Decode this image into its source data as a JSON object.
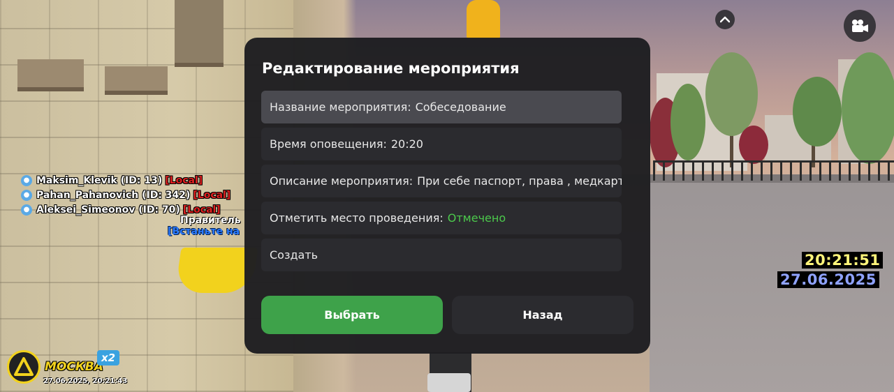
{
  "dialog": {
    "title": "Редактирование мероприятия",
    "items": [
      {
        "label": "Название мероприятия:",
        "value": "Собеседование"
      },
      {
        "label": "Время оповещения:",
        "value": "20:20"
      },
      {
        "label": "Описание мероприятия:",
        "value": " При себе паспорт, права , медкарта"
      },
      {
        "label": "Отметить место проведения:",
        "value": "Отмечено",
        "value_color": "#4cc94c"
      },
      {
        "label": "Создать"
      }
    ],
    "select_label": "Выбрать",
    "back_label": "Назад"
  },
  "players": [
    {
      "name": "Maksim_Klevik (ID: 13)",
      "tag": "[Local]"
    },
    {
      "name": "Pahan_Pahanovich (ID: 342)",
      "tag": "[Local]"
    },
    {
      "name": "Aleksei_Simeonov (ID: 70)",
      "tag": "[Local]"
    }
  ],
  "npc_labels": {
    "line1": "Правитель",
    "line2": "[Встаньте на"
  },
  "clock": {
    "time": "20:21:51",
    "date": "27.06.2025"
  },
  "server": {
    "city": "МОСКВА",
    "multiplier": "x2",
    "datetime": "27.06.2025, 20:21:43"
  },
  "icons": {
    "collapse": "chevron-up-icon",
    "camera": "video-camera-icon",
    "voice": "microphone-icon",
    "logo": "server-logo-icon"
  },
  "colors": {
    "accent_green": "#3ea24a",
    "success_text": "#4cc94c",
    "local_tag": "#e02020",
    "logo_yellow": "#f2d21d"
  }
}
